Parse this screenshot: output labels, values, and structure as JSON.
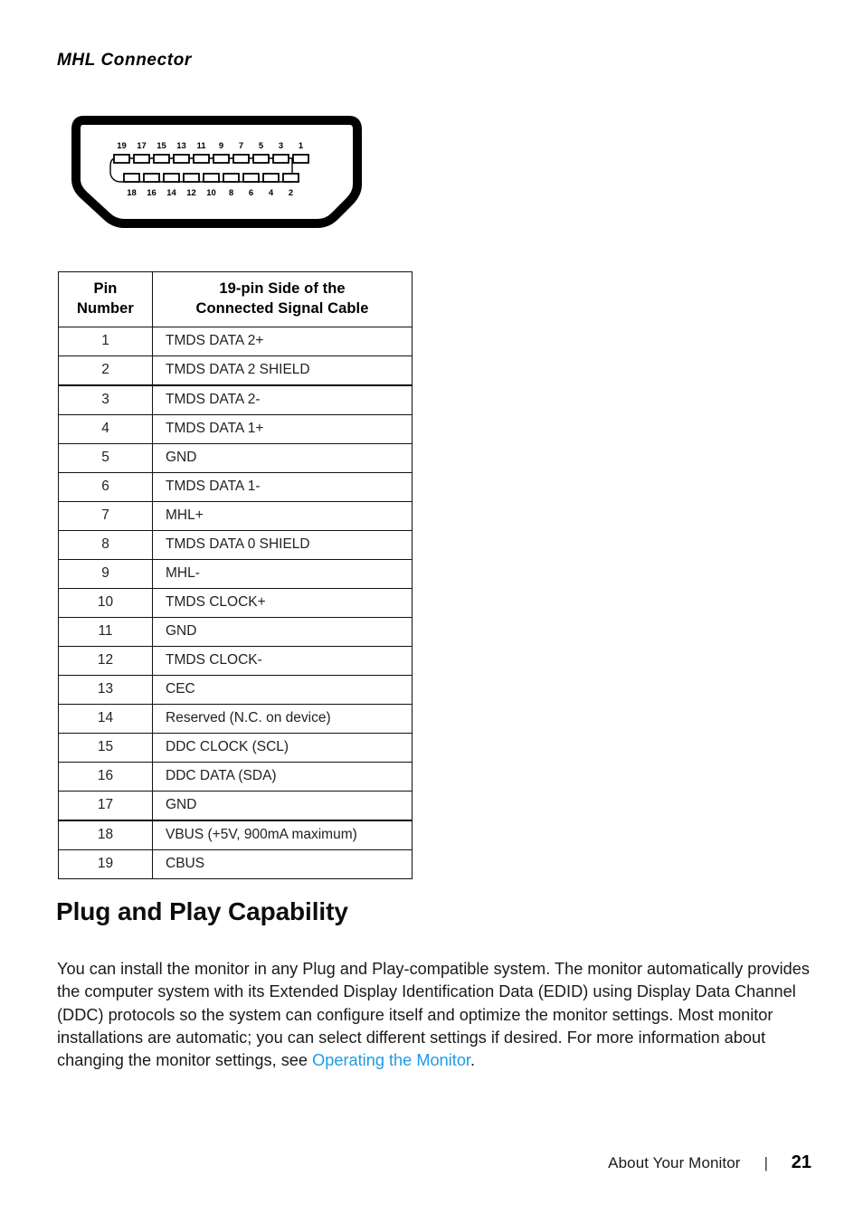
{
  "document": {
    "section_heading": "MHL Connector",
    "page_heading": "Plug and Play Capability"
  },
  "connector_diagram": {
    "name": "hdmi-mhl-19-pin-connector",
    "top_row_pins": [
      "19",
      "17",
      "15",
      "13",
      "11",
      "9",
      "7",
      "5",
      "3",
      "1"
    ],
    "bottom_row_pins": [
      "18",
      "16",
      "14",
      "12",
      "10",
      "8",
      "6",
      "4",
      "2"
    ]
  },
  "pin_table": {
    "headers": {
      "pin_number": "Pin\nNumber",
      "pin_number_line1": "Pin",
      "pin_number_line2": "Number",
      "signal_line1": "19-pin Side of the",
      "signal_line2": "Connected Signal Cable"
    },
    "rows": [
      {
        "pin": "1",
        "signal": "TMDS DATA 2+"
      },
      {
        "pin": "2",
        "signal": "TMDS DATA 2 SHIELD"
      },
      {
        "pin": "3",
        "signal": "TMDS DATA 2-"
      },
      {
        "pin": "4",
        "signal": "TMDS DATA 1+"
      },
      {
        "pin": "5",
        "signal": "GND"
      },
      {
        "pin": "6",
        "signal": "TMDS DATA 1-"
      },
      {
        "pin": "7",
        "signal": "MHL+"
      },
      {
        "pin": "8",
        "signal": "TMDS DATA 0 SHIELD"
      },
      {
        "pin": "9",
        "signal": "MHL-"
      },
      {
        "pin": "10",
        "signal": "TMDS CLOCK+"
      },
      {
        "pin": "11",
        "signal": "GND"
      },
      {
        "pin": "12",
        "signal": "TMDS CLOCK-"
      },
      {
        "pin": "13",
        "signal": "CEC"
      },
      {
        "pin": "14",
        "signal": "Reserved (N.C. on device)"
      },
      {
        "pin": "15",
        "signal": "DDC CLOCK (SCL)"
      },
      {
        "pin": "16",
        "signal": "DDC DATA (SDA)"
      },
      {
        "pin": "17",
        "signal": "GND"
      },
      {
        "pin": "18",
        "signal": "VBUS (+5V, 900mA maximum)"
      },
      {
        "pin": "19",
        "signal": "CBUS"
      }
    ]
  },
  "body": {
    "paragraph_before_link": "You can install the monitor in any Plug and Play-compatible system. The monitor automatically provides the computer system with its Extended Display Identification Data (EDID) using Display Data Channel (DDC) protocols so the system can configure itself and optimize the monitor settings. Most monitor installations are automatic; you can select different settings if desired. For more information about changing the monitor settings, see ",
    "link_text": "Operating the Monitor",
    "paragraph_after_link": ".",
    "link_color": "#1f9ae8"
  },
  "footer": {
    "label": "About Your Monitor",
    "separator": "|",
    "page_number": "21"
  }
}
